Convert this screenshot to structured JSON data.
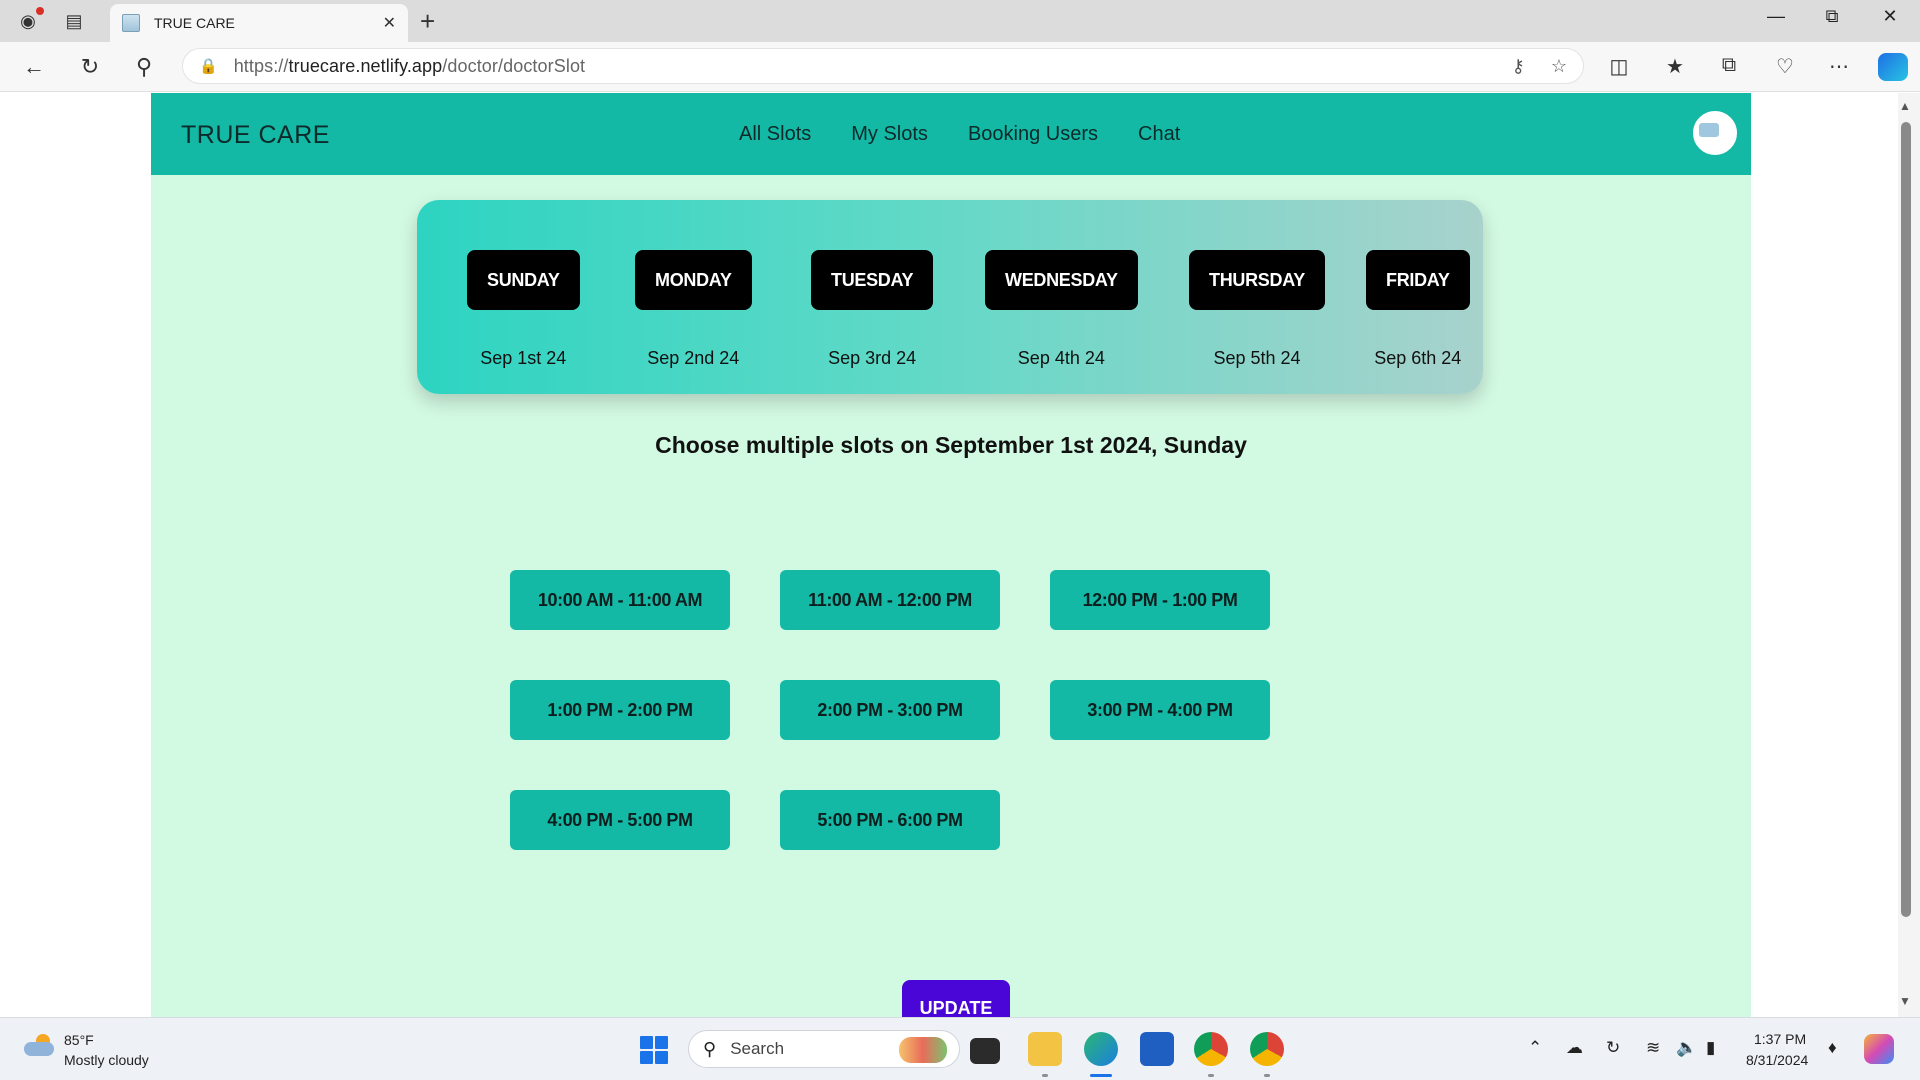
{
  "browser": {
    "tab_title": "TRUE CARE",
    "url_prefix": "https://",
    "url_domain": "truecare.netlify.app",
    "url_path": "/doctor/doctorSlot"
  },
  "app": {
    "brand": "TRUE CARE",
    "nav": [
      {
        "label": "All Slots"
      },
      {
        "label": "My Slots"
      },
      {
        "label": "Booking Users"
      },
      {
        "label": "Chat"
      }
    ],
    "days": [
      {
        "day": "SUNDAY",
        "date": "Sep 1st 24"
      },
      {
        "day": "MONDAY",
        "date": "Sep 2nd 24"
      },
      {
        "day": "TUESDAY",
        "date": "Sep 3rd 24"
      },
      {
        "day": "WEDNESDAY",
        "date": "Sep 4th 24"
      },
      {
        "day": "THURSDAY",
        "date": "Sep 5th 24"
      },
      {
        "day": "FRIDAY",
        "date": "Sep 6th 24"
      }
    ],
    "heading": "Choose multiple slots on September 1st 2024, Sunday",
    "slots": [
      "10:00 AM - 11:00 AM",
      "11:00 AM - 12:00 PM",
      "12:00 PM - 1:00 PM",
      "1:00 PM - 2:00 PM",
      "2:00 PM - 3:00 PM",
      "3:00 PM - 4:00 PM",
      "4:00 PM - 5:00 PM",
      "5:00 PM - 6:00 PM"
    ],
    "update_label": "UPDATE"
  },
  "taskbar": {
    "temperature": "85°F",
    "weather": "Mostly cloudy",
    "search_label": "Search",
    "time": "1:37 PM",
    "date": "8/31/2024"
  },
  "colors": {
    "navbar": "#13b9a5",
    "page_background": "#d2f9e2",
    "day_button": "#000000",
    "slot_button": "#13b9a5",
    "update_button": "#4a06d6"
  }
}
